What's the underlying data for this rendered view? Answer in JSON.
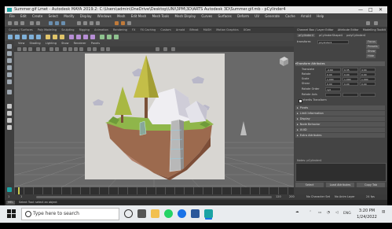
{
  "window": {
    "title": "Summer.gif Lmet - Autodesk MAYA 2019.2: C:\\Users\\admin\\OneDrive\\Desktop\\UNI\\3PM\\3D\\ARTS Autodesk 3D\\Summer.gif.mb - pCylinder4",
    "controls": [
      "—",
      "□",
      "✕"
    ]
  },
  "menubar": [
    "File",
    "Edit",
    "Create",
    "Select",
    "Modify",
    "Display",
    "Windows",
    "Mesh",
    "Edit Mesh",
    "Mesh Tools",
    "Mesh Display",
    "Curves",
    "Surfaces",
    "Deform",
    "UV",
    "Generate",
    "Cache",
    "Arnold",
    "Help"
  ],
  "shelf_tabs": [
    "Curves / Surfaces",
    "Poly Modeling",
    "Sculpting",
    "Rigging",
    "Animation",
    "Rendering",
    "FX",
    "FX Caching",
    "Custom",
    "Arnold",
    "Bifrost",
    "MASH",
    "Motion Graphics",
    "XGen"
  ],
  "viewport": {
    "menu": [
      "View",
      "Shading",
      "Lighting",
      "Show",
      "Renderer",
      "Panels"
    ],
    "colors": {
      "background": "#6a6a6a",
      "image_plane": "#d8d6d2",
      "grass": "#8fb64a",
      "cliff": "#9c6a4e"
    }
  },
  "channel_box": {
    "tabs": [
      "Channel Box / Layer Editor",
      "Attribute Editor",
      "Modelling Toolkit"
    ],
    "node_tabs": [
      "pCylinder4",
      "pCylinderShape4",
      "polyCylinder4"
    ],
    "transform_label": "transform:",
    "transform_value": "pCylinder4",
    "focus_btn": "Focus",
    "presets_btn": "Presets",
    "show_btn": "Show",
    "hide_btn": "Hide",
    "section_title": "Transform Attributes",
    "attributes": [
      {
        "label": "Translate",
        "x": "-4.69",
        "y": "0.35",
        "z": "4.04"
      },
      {
        "label": "Rotate",
        "x": "0.00",
        "y": "0.00",
        "z": "0.00"
      },
      {
        "label": "Scale",
        "x": "1.000",
        "y": "1.000",
        "z": "1.000"
      },
      {
        "label": "Shear",
        "x": "0.00",
        "y": "0.00",
        "z": "0.00"
      }
    ],
    "rotate_order_label": "Rotate Order",
    "rotate_order_value": "xyz",
    "rotate_axis_label": "Rotate Axis",
    "inherits_label": "Inherits Transform",
    "sections": [
      "Pivots",
      "Limit Information",
      "Display",
      "Node Behavior",
      "UUID",
      "Extra Attributes"
    ],
    "notes_label": "Notes: pCylinder4",
    "buttons": [
      "Select",
      "Load Attributes",
      "Copy Tab"
    ]
  },
  "time": {
    "start": "1",
    "end": "120",
    "range_end": "200",
    "no_character_set": "No Character Set",
    "no_anim_layer": "No Anim Layer",
    "fps": "24 fps"
  },
  "command_line": {
    "mel_label": "MEL",
    "tooltip": "Select Tool: select an object"
  },
  "taskbar": {
    "search_placeholder": "Type here to search",
    "clock_time": "3:20 PM",
    "clock_date": "1/24/2022",
    "language": "ENG",
    "colors": {
      "chrome": "#1a73e8",
      "maya": "#1ba3a3",
      "whatsapp": "#25d366",
      "word": "#2b579a",
      "files": "#f2c04f"
    }
  }
}
